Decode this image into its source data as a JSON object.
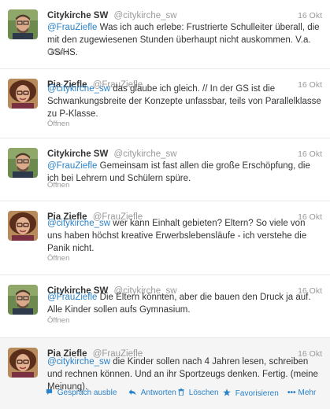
{
  "tweets": [
    {
      "name": "Citykirche SW",
      "handle": "@citykirche_sw",
      "time": "16 Okt",
      "mention": "@FrauZiefle",
      "body": " Was ich auch erlebe: Frustrierte Schulleiter überall, die mit den zugewiesenen Stunden überhaupt nicht auskommen. V.a. GS/HS.",
      "open": "Öffnen",
      "avatar": "man-with-glasses-avatar"
    },
    {
      "name": "Pia Ziefle",
      "handle": "@FrauZiefle",
      "time": "16 Okt",
      "mention": "@citykirche_sw",
      "body": " das glaube ich gleich. // In der GS ist die Schwankungsbreite der Konzepte unfassbar, teils von Parallelklasse zu P-Klasse.",
      "open": "Öffnen",
      "avatar": "woman-with-curly-hair-avatar"
    },
    {
      "name": "Citykirche SW",
      "handle": "@citykirche_sw",
      "time": "16 Okt",
      "mention": "@FrauZiefle",
      "body": " Gemeinsam ist fast allen die große Erschöpfung, die ich bei Lehrern und Schülern spüre.",
      "open": "Öffnen",
      "avatar": "man-with-glasses-avatar"
    },
    {
      "name": "Pia Ziefle",
      "handle": "@FrauZiefle",
      "time": "16 Okt",
      "mention": "@citykirche_sw",
      "body": " wer kann Einhalt gebieten? Eltern? So viele von uns haben höchst kreative Erwerbslebensläufe - ich verstehe die Panik nicht.",
      "open": "Öffnen",
      "avatar": "woman-with-curly-hair-avatar"
    },
    {
      "name": "Citykirche SW",
      "handle": "@citykirche_sw",
      "time": "16 Okt",
      "mention": "@FrauZiefle",
      "body": " Die Eltern könnten, aber die bauen den Druck ja auf. Alle Kinder sollen aufs Gymnasium.",
      "open": "Öffnen",
      "avatar": "man-with-glasses-avatar"
    },
    {
      "name": "Pia Ziefle",
      "handle": "@FrauZiefle",
      "time": "16 Okt",
      "mention": "@citykirche_sw",
      "body": " die Kinder sollen nach 4 Jahren lesen, schreiben und rechnen können. Und an ihr Sportzeugs denken. Fertig. (meine Meinung).",
      "avatar": "woman-with-curly-hair-avatar"
    }
  ],
  "actions": {
    "hide_conversation": "Gespräch ausble",
    "reply": "Antworten",
    "delete": "Löschen",
    "favorite": "Favorisieren",
    "more": "Mehr"
  },
  "colors": {
    "link": "#2a82c8",
    "muted": "#999999",
    "text": "#333333"
  }
}
